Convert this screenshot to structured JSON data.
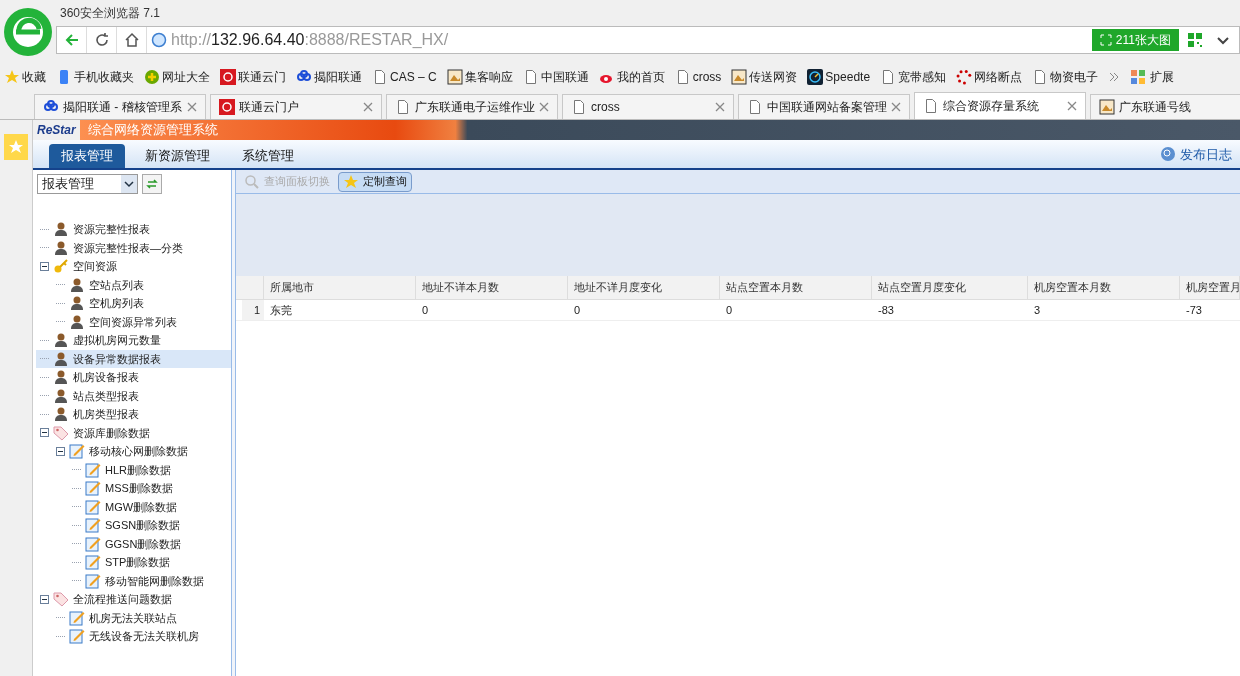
{
  "window": {
    "title": "360安全浏览器 7.1"
  },
  "address": {
    "scheme": "http://",
    "host": "132.96.64.40",
    "rest": ":8888/RESTAR_HX/"
  },
  "image_badge": "211张大图",
  "bookmarks": [
    {
      "label": "收藏",
      "kind": "star"
    },
    {
      "label": "手机收藏夹",
      "kind": "phone"
    },
    {
      "label": "网址大全",
      "kind": "plus"
    },
    {
      "label": "联通云门",
      "kind": "unicom"
    },
    {
      "label": "揭阳联通",
      "kind": "knot"
    },
    {
      "label": "CAS – C",
      "kind": "page"
    },
    {
      "label": "集客响应",
      "kind": "photo"
    },
    {
      "label": "中国联通",
      "kind": "page"
    },
    {
      "label": "我的首页",
      "kind": "weibo"
    },
    {
      "label": "cross",
      "kind": "page"
    },
    {
      "label": "传送网资",
      "kind": "photo"
    },
    {
      "label": "Speedte",
      "kind": "gauge"
    },
    {
      "label": "宽带感知",
      "kind": "page"
    },
    {
      "label": "网络断点",
      "kind": "dots"
    },
    {
      "label": "物资电子",
      "kind": "page"
    }
  ],
  "extensions_label": "扩展",
  "tabs": [
    {
      "label": "揭阳联通 - 稽核管理系",
      "kind": "knot",
      "selected": false,
      "closable": true
    },
    {
      "label": "联通云门户",
      "kind": "unicom",
      "selected": false,
      "closable": true
    },
    {
      "label": "广东联通电子运维作业",
      "kind": "page",
      "selected": false,
      "closable": true
    },
    {
      "label": "cross",
      "kind": "page",
      "selected": false,
      "closable": true
    },
    {
      "label": "中国联通网站备案管理",
      "kind": "page",
      "selected": false,
      "closable": true
    },
    {
      "label": "综合资源存量系统",
      "kind": "page",
      "selected": true,
      "closable": true
    },
    {
      "label": "广东联通号线",
      "kind": "photo",
      "selected": false,
      "closable": false
    }
  ],
  "app": {
    "logo": "ReStar",
    "title": "综合网络资源管理系统",
    "nav": [
      {
        "label": "报表管理",
        "selected": true
      },
      {
        "label": "新资源管理",
        "selected": false
      },
      {
        "label": "系统管理",
        "selected": false
      }
    ],
    "release_log": "发布日志"
  },
  "sidebar": {
    "select_value": "报表管理",
    "tree": [
      {
        "label": "资源完整性报表",
        "kind": "person",
        "selected": false
      },
      {
        "label": "资源完整性报表—分类",
        "kind": "person",
        "selected": false
      },
      {
        "label": "空间资源",
        "kind": "key",
        "selected": false,
        "expanded": true,
        "children": [
          {
            "label": "空站点列表",
            "kind": "person",
            "selected": false
          },
          {
            "label": "空机房列表",
            "kind": "person",
            "selected": false
          },
          {
            "label": "空间资源异常列表",
            "kind": "person",
            "selected": false
          }
        ]
      },
      {
        "label": "虚拟机房网元数量",
        "kind": "person",
        "selected": false
      },
      {
        "label": "设备异常数据报表",
        "kind": "person",
        "selected": true
      },
      {
        "label": "机房设备报表",
        "kind": "person",
        "selected": false
      },
      {
        "label": "站点类型报表",
        "kind": "person",
        "selected": false
      },
      {
        "label": "机房类型报表",
        "kind": "person",
        "selected": false
      },
      {
        "label": "资源库删除数据",
        "kind": "tag",
        "selected": false,
        "expanded": true,
        "children": [
          {
            "label": "移动核心网删除数据",
            "kind": "note",
            "selected": false,
            "expanded": true,
            "children": [
              {
                "label": "HLR删除数据",
                "kind": "note",
                "selected": false
              },
              {
                "label": "MSS删除数据",
                "kind": "note",
                "selected": false
              },
              {
                "label": "MGW删除数据",
                "kind": "note",
                "selected": false
              },
              {
                "label": "SGSN删除数据",
                "kind": "note",
                "selected": false
              },
              {
                "label": "GGSN删除数据",
                "kind": "note",
                "selected": false
              },
              {
                "label": "STP删除数据",
                "kind": "note",
                "selected": false
              },
              {
                "label": "移动智能网删除数据",
                "kind": "note",
                "selected": false
              }
            ]
          }
        ]
      },
      {
        "label": "全流程推送问题数据",
        "kind": "tag",
        "selected": false,
        "expanded": true,
        "children": [
          {
            "label": "机房无法关联站点",
            "kind": "note",
            "selected": false
          },
          {
            "label": "无线设备无法关联机房",
            "kind": "note",
            "selected": false
          }
        ]
      }
    ]
  },
  "toolbar": [
    {
      "label": "查询面板切换",
      "kind": "search",
      "disabled": true
    },
    {
      "label": "定制查询",
      "kind": "star",
      "disabled": false
    }
  ],
  "table": {
    "columns": [
      "所属地市",
      "地址不详本月数",
      "地址不详月度变化",
      "站点空置本月数",
      "站点空置月度变化",
      "机房空置本月数",
      "机房空置月"
    ],
    "rows": [
      {
        "index": "1",
        "cells": [
          "东莞",
          "0",
          "0",
          "0",
          "-83",
          "3",
          "-73"
        ]
      }
    ]
  }
}
